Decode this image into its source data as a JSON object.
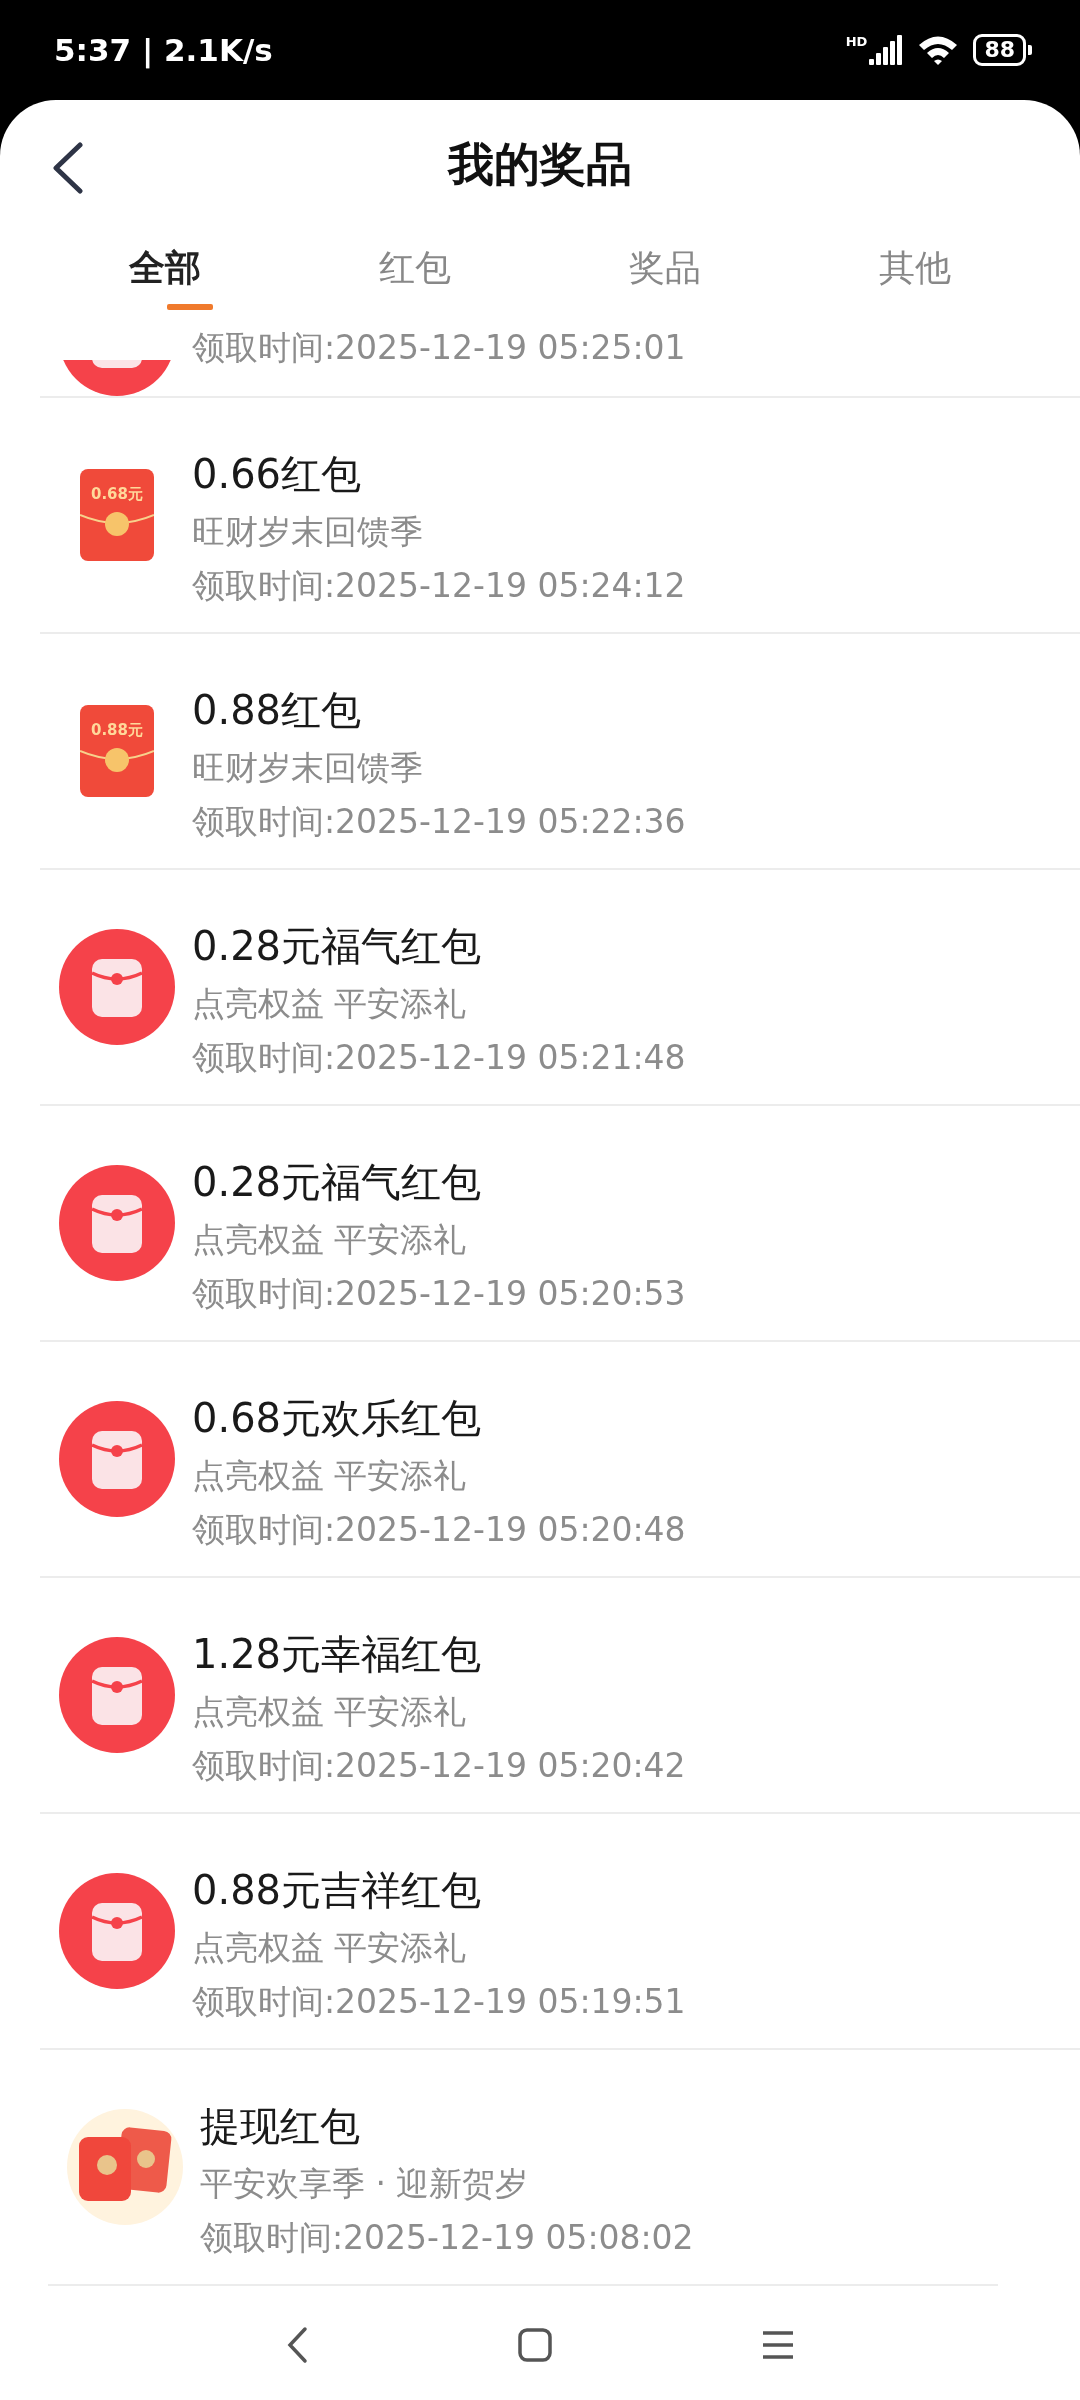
{
  "status_bar": {
    "time": "5:37 | 2.1K/s",
    "network": "HD",
    "battery": "88"
  },
  "header": {
    "title": "我的奖品"
  },
  "tabs": [
    {
      "label": "全部",
      "selected": true
    },
    {
      "label": "红包",
      "selected": false
    },
    {
      "label": "奖品",
      "selected": false
    },
    {
      "label": "其他",
      "selected": false
    }
  ],
  "items": [
    {
      "kind": "circle",
      "time": "领取时间:2025-12-19 05:25:01"
    },
    {
      "kind": "envelope",
      "badge": "0.68元",
      "title": "0.66红包",
      "subtitle": "旺财岁末回馈季",
      "time": "领取时间:2025-12-19 05:24:12"
    },
    {
      "kind": "envelope",
      "badge": "0.88元",
      "title": "0.88红包",
      "subtitle": "旺财岁末回馈季",
      "time": "领取时间:2025-12-19 05:22:36"
    },
    {
      "kind": "circle",
      "title": "0.28元福气红包",
      "subtitle": "点亮权益 平安添礼",
      "time": "领取时间:2025-12-19 05:21:48"
    },
    {
      "kind": "circle",
      "title": "0.28元福气红包",
      "subtitle": "点亮权益 平安添礼",
      "time": "领取时间:2025-12-19 05:20:53"
    },
    {
      "kind": "circle",
      "title": "0.68元欢乐红包",
      "subtitle": "点亮权益 平安添礼",
      "time": "领取时间:2025-12-19 05:20:48"
    },
    {
      "kind": "circle",
      "title": "1.28元幸福红包",
      "subtitle": "点亮权益 平安添礼",
      "time": "领取时间:2025-12-19 05:20:42"
    },
    {
      "kind": "circle",
      "title": "0.88元吉祥红包",
      "subtitle": "点亮权益 平安添礼",
      "time": "领取时间:2025-12-19 05:19:51"
    },
    {
      "kind": "pair",
      "title": "提现红包",
      "subtitle": "平安欢享季 · 迎新贺岁",
      "time": "领取时间:2025-12-19 05:08:02"
    }
  ]
}
